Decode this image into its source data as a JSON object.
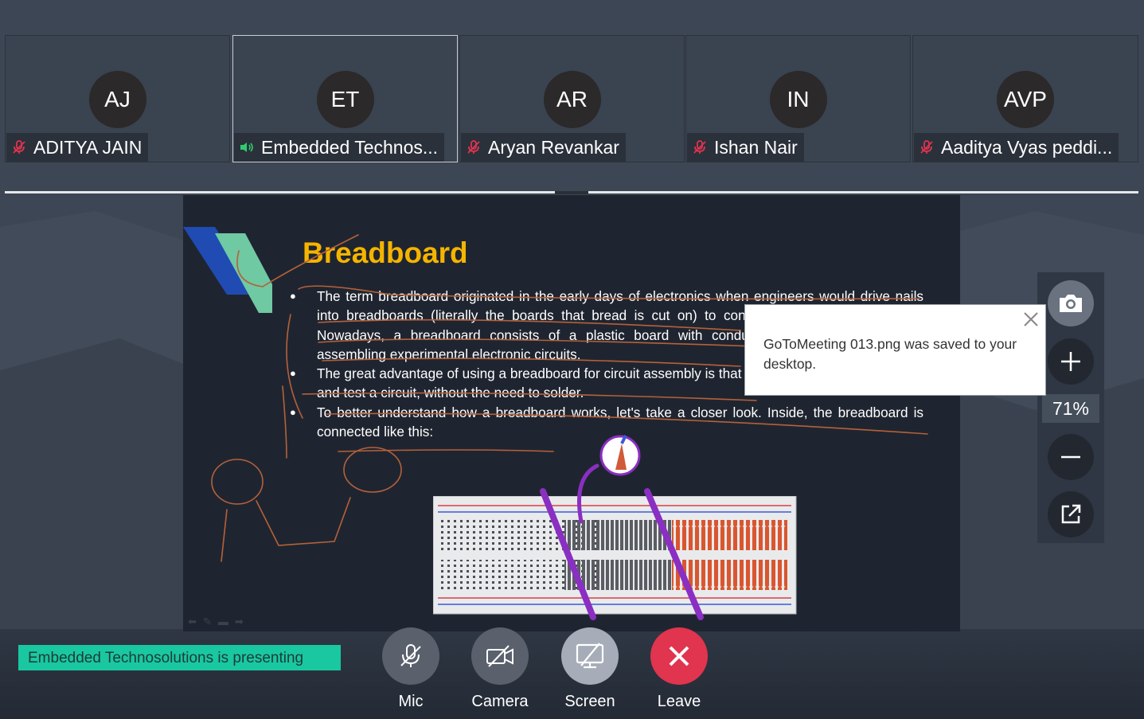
{
  "participants": [
    {
      "initials": "AJ",
      "name": "ADITYA JAIN",
      "audio": "muted",
      "active": false
    },
    {
      "initials": "ET",
      "name": "Embedded Technos...",
      "audio": "speaking",
      "active": true
    },
    {
      "initials": "AR",
      "name": "Aryan Revankar",
      "audio": "muted",
      "active": false
    },
    {
      "initials": "IN",
      "name": "Ishan Nair",
      "audio": "muted",
      "active": false
    },
    {
      "initials": "AVP",
      "name": "Aaditya Vyas peddi...",
      "audio": "muted",
      "active": false
    }
  ],
  "slide": {
    "title": "Breadboard",
    "bullets": [
      "The term breadboard originated in the early days of electronics when engineers would drive nails into breadboards (literally the boards that bread is cut on) to connect electronic components. Nowadays, a breadboard consists of a plastic board with conductive connections used for assembling experimental electronic circuits.",
      "The great advantage of using a breadboard for circuit assembly is that you can connect components and test a circuit, without the need to solder.",
      "To better understand how a breadboard works, let's take a closer look. Inside, the breadboard is connected like this:"
    ],
    "title_color": "#f5b400"
  },
  "zoom": {
    "level": "71%"
  },
  "toast": {
    "message": "GoToMeeting 013.png was saved to your desktop."
  },
  "presenting": {
    "text": "Embedded Technosolutions  is presenting"
  },
  "controls": [
    {
      "label": "Mic",
      "icon": "mic-off-icon",
      "state": "off"
    },
    {
      "label": "Camera",
      "icon": "camera-off-icon",
      "state": "off"
    },
    {
      "label": "Screen",
      "icon": "screen-share-icon",
      "state": "on"
    },
    {
      "label": "Leave",
      "icon": "close-icon",
      "state": "danger"
    }
  ],
  "colors": {
    "accent": "#19c8a0",
    "danger": "#e0344f",
    "muted_mic": "#e0344f",
    "speaking": "#2ecc71"
  }
}
